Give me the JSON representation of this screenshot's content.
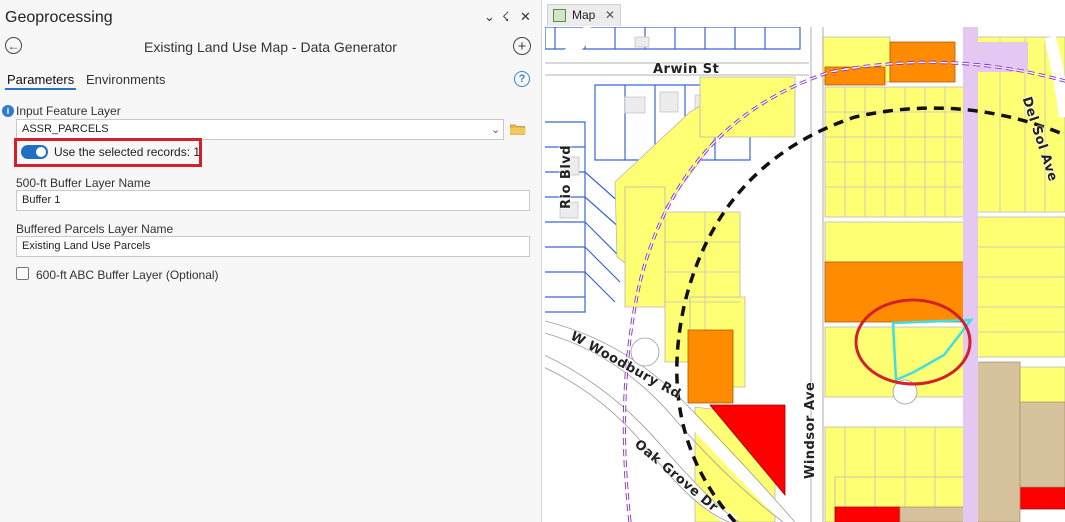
{
  "panel": {
    "title": "Geoprocessing",
    "pin_symbol": "☇",
    "tool_title": "Existing Land Use Map - Data Generator",
    "tabs": [
      "Parameters",
      "Environments"
    ],
    "help_symbol": "?",
    "info_symbol": "i",
    "back_symbol": "←",
    "add_symbol": "+"
  },
  "params": {
    "input_label": "Input Feature Layer",
    "input_value": "ASSR_PARCELS",
    "toggle_label": "Use the selected records: 1",
    "toggle_on": true,
    "buffer_label": "500-ft Buffer Layer Name",
    "buffer_value": "Buffer 1",
    "parcels_label": "Buffered Parcels Layer Name",
    "parcels_value": "Existing Land Use Parcels",
    "abc_label": "600-ft ABC Buffer Layer (Optional)",
    "abc_checked": false
  },
  "map_tab": {
    "label": "Map"
  },
  "map": {
    "street_labels": [
      "Arwin St",
      "Del Sol Ave",
      "Rio Blvd",
      "W Woodbury Rd",
      "Oak Grove Dr",
      "Windsor Ave"
    ]
  },
  "colors": {
    "accent": "#1f6fc2",
    "highlight_red": "#d3202a",
    "parcel_yellow": "#ffff73",
    "parcel_orange": "#ff8c00",
    "parcel_red": "#ff0000",
    "parcel_tan": "#d7c29e",
    "road_purple": "#e4c8f2",
    "buffer_purple": "#a050d0",
    "selection_cyan": "#3de0e0"
  }
}
